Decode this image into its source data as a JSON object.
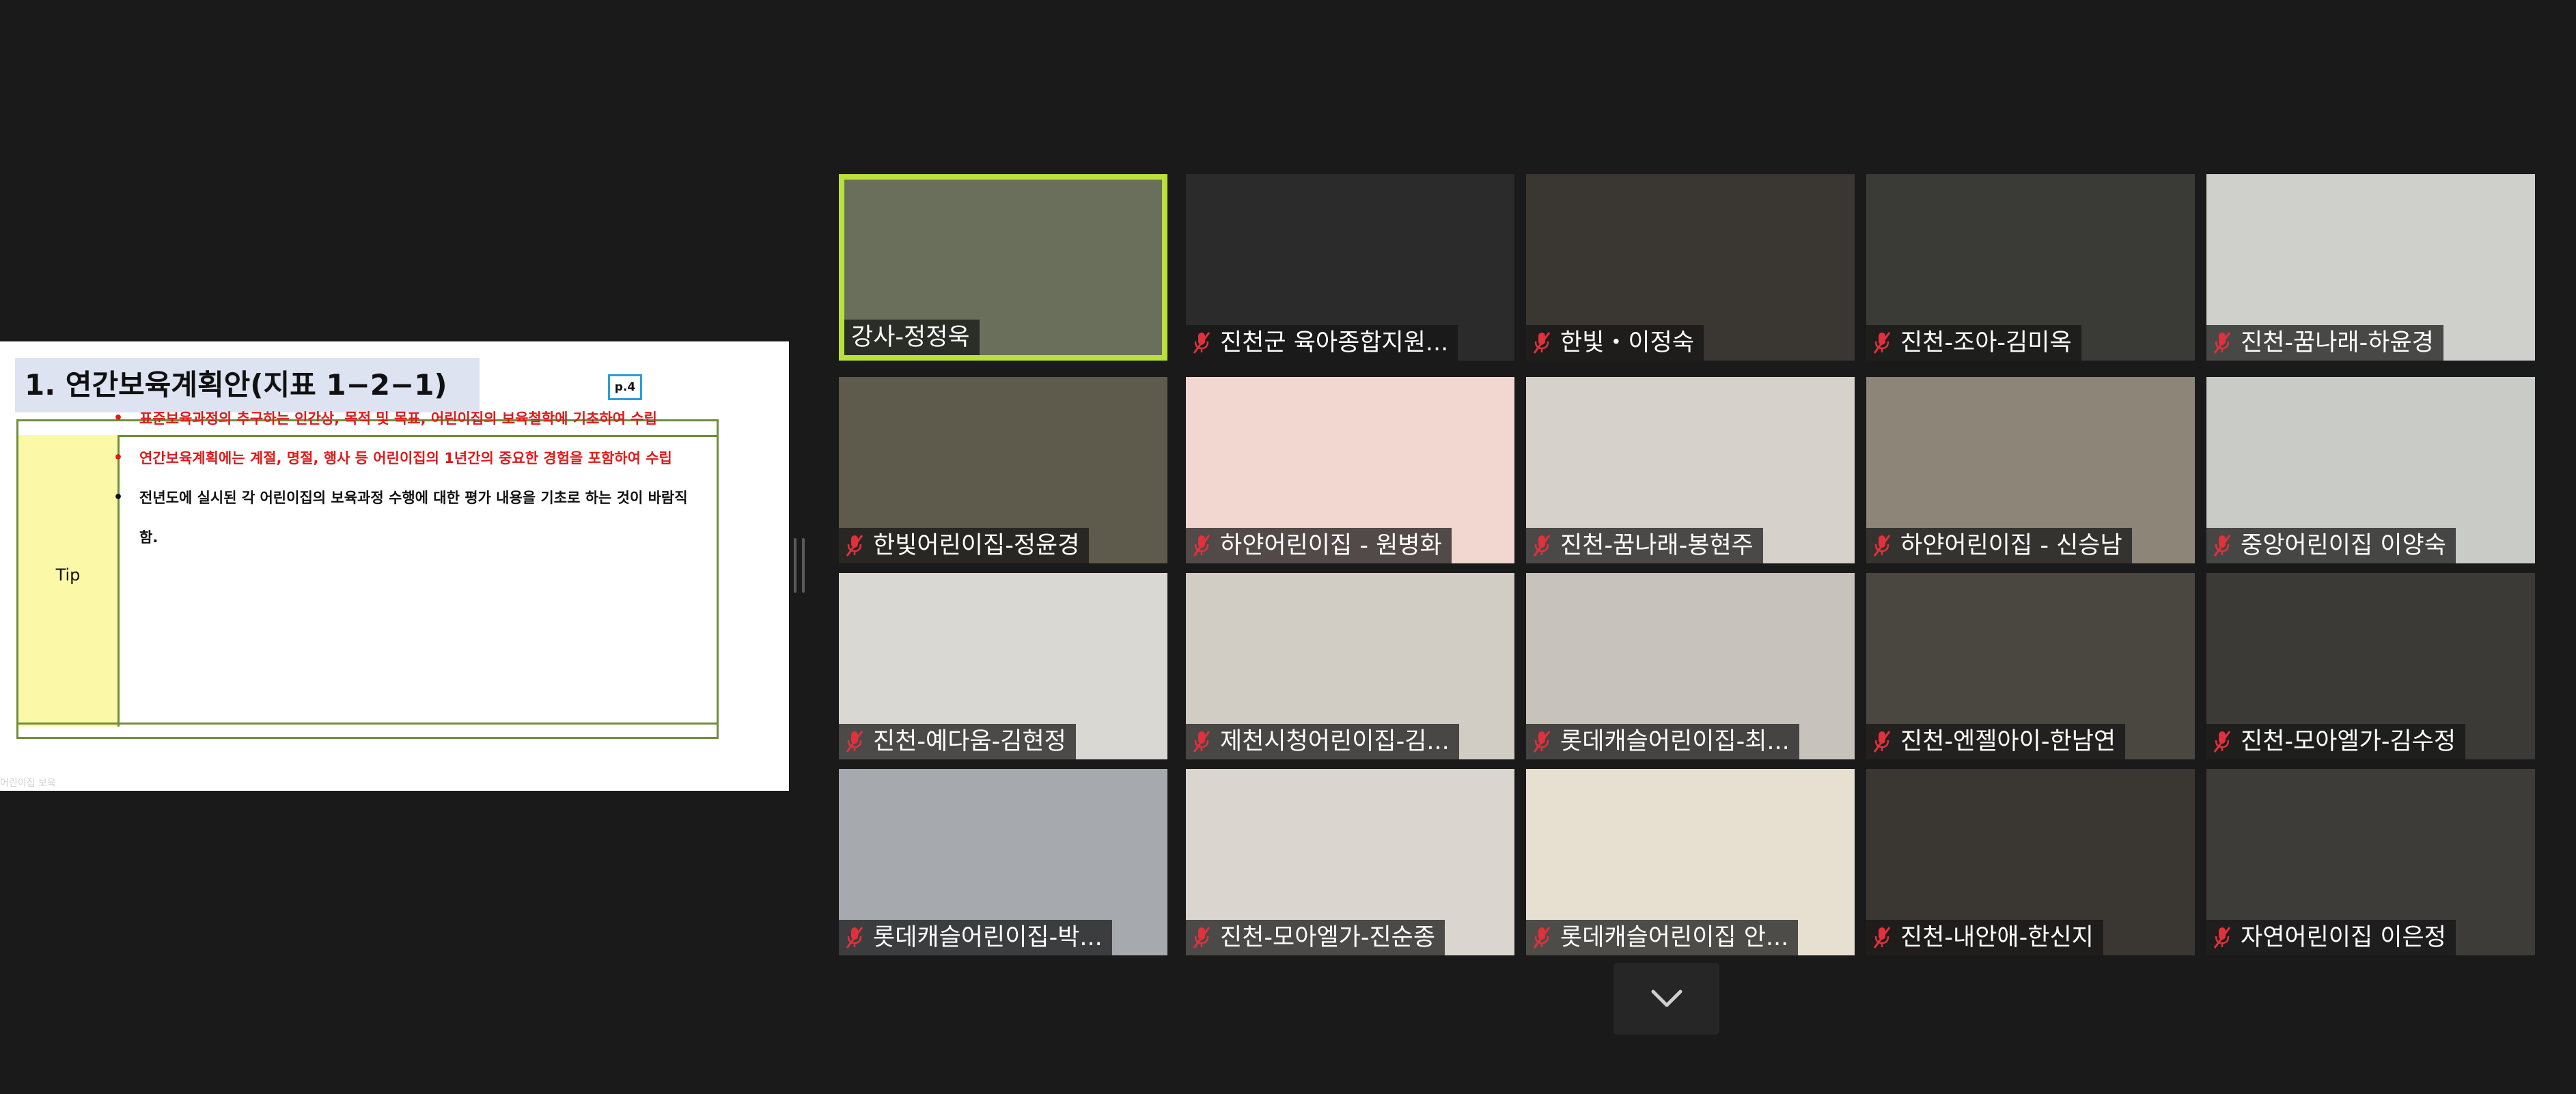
{
  "slide": {
    "title": "1. 연간보육계획안(지표 1−2−1)",
    "page_badge": "p.4",
    "tip_label": "Tip",
    "bullets": [
      {
        "text": "표준보육과정의 추구하는 인간상, 목적 및 목표, 어린이집의 보육철학에 기초하여 수립",
        "color": "red"
      },
      {
        "text": "연간보육계획에는 계절, 명절, 행사 등 어린이집의 1년간의 중요한 경험을 포함하여 수립",
        "color": "red"
      },
      {
        "text": "전년도에 실시된 각 어린이집의 보육과정 수행에 대한 평가 내용을 기초로 하는 것이 바람직함.",
        "color": "black"
      }
    ],
    "footer": "어린이집 보육"
  },
  "participants": [
    {
      "name": "강사-정정욱",
      "muted": false,
      "active": true,
      "bg": "#6a6f5c"
    },
    {
      "name": "진천군 육아종합지원...",
      "muted": true,
      "active": false,
      "bg": "#2b2b2b"
    },
    {
      "name": "한빛・이정숙",
      "muted": true,
      "active": false,
      "bg": "#3a3631"
    },
    {
      "name": "진천-조아-김미옥",
      "muted": true,
      "active": false,
      "bg": "#3a3a36"
    },
    {
      "name": "진천-꿈나래-하윤경",
      "muted": true,
      "active": false,
      "bg": "#cfcfcb"
    },
    {
      "name": "한빛어린이집-정윤경",
      "muted": true,
      "active": false,
      "bg": "#5e5b4c"
    },
    {
      "name": "하얀어린이집 - 원병화",
      "muted": true,
      "active": false,
      "bg": "#f1d7cf"
    },
    {
      "name": "진천-꿈나래-봉현주",
      "muted": true,
      "active": false,
      "bg": "#d6d2cb"
    },
    {
      "name": "하얀어린이집 - 신승남",
      "muted": true,
      "active": false,
      "bg": "#8c8578"
    },
    {
      "name": "중앙어린이집 이양숙",
      "muted": true,
      "active": false,
      "bg": "#c9cbc6"
    },
    {
      "name": "진천-예다움-김현정",
      "muted": true,
      "active": false,
      "bg": "#d9d8d2"
    },
    {
      "name": "제천시청어린이집-김...",
      "muted": true,
      "active": false,
      "bg": "#d1ccc4"
    },
    {
      "name": "롯데캐슬어린이집-최...",
      "muted": true,
      "active": false,
      "bg": "#c7c3bc"
    },
    {
      "name": "진천-엔젤아이-한남연",
      "muted": true,
      "active": false,
      "bg": "#4a4640"
    },
    {
      "name": "진천-모아엘가-김수정",
      "muted": true,
      "active": false,
      "bg": "#3b3a37"
    },
    {
      "name": "롯데캐슬어린이집-박...",
      "muted": true,
      "active": false,
      "bg": "#a6a9ad"
    },
    {
      "name": "진천-모아엘가-진순종",
      "muted": true,
      "active": false,
      "bg": "#dad6cf"
    },
    {
      "name": "롯데캐슬어린이집 안...",
      "muted": true,
      "active": false,
      "bg": "#e7dfcf"
    },
    {
      "name": "진천-내안애-한신지",
      "muted": true,
      "active": false,
      "bg": "#3a3733"
    },
    {
      "name": "자연어린이집 이은정",
      "muted": true,
      "active": false,
      "bg": "#3d3c39"
    }
  ],
  "colors": {
    "active_speaker_border": "#b9e13a",
    "muted_mic": "#e0313d",
    "background": "#1a1a1a"
  },
  "icons": {
    "muted": "mic-muted-icon",
    "scroll": "chevron-down-icon"
  }
}
